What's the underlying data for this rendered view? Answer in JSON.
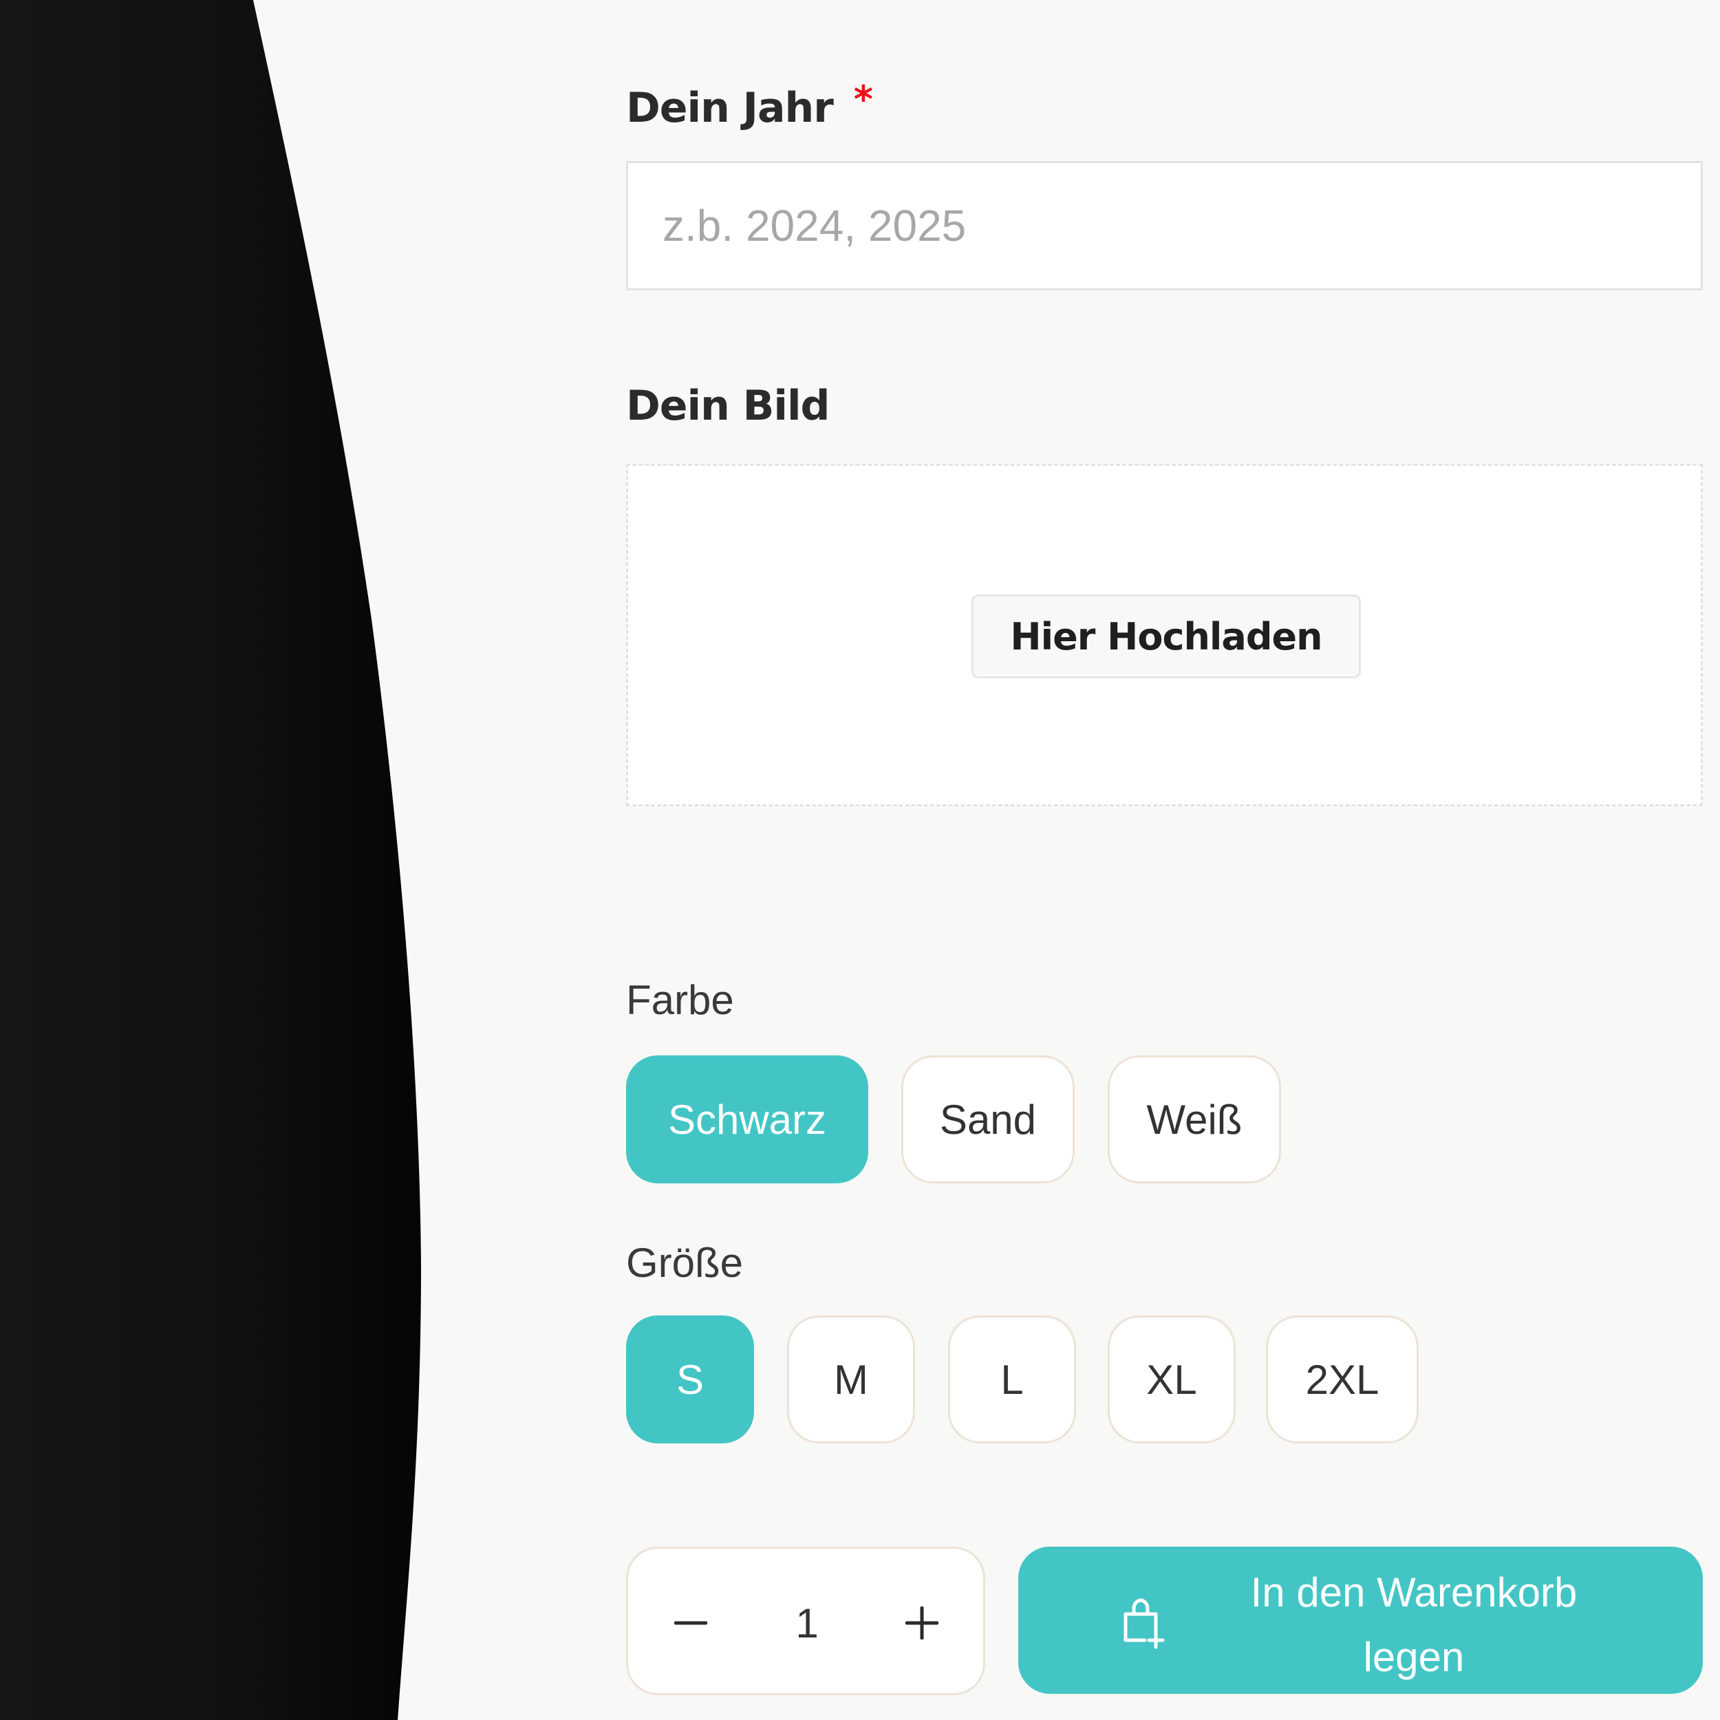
{
  "product_image": {
    "icon": "black-tshirt-edge"
  },
  "year_field": {
    "label": "Dein Jahr",
    "required_marker": "*",
    "value": "",
    "placeholder": "z.b. 2024, 2025"
  },
  "image_field": {
    "label": "Dein Bild",
    "upload_button_label": "Hier Hochladen"
  },
  "color_option": {
    "label": "Farbe",
    "choices": [
      "Schwarz",
      "Sand",
      "Weiß"
    ],
    "selected": "Schwarz"
  },
  "size_option": {
    "label": "Größe",
    "choices": [
      "S",
      "M",
      "L",
      "XL",
      "2XL"
    ],
    "selected": "S"
  },
  "quantity": {
    "value": "1",
    "decrement_icon": "minus-icon",
    "increment_icon": "plus-icon"
  },
  "cart_button": {
    "label": "In den Warenkorb legen",
    "icon": "shopping-bag-plus-icon"
  },
  "colors": {
    "accent": "#43c5c5",
    "required": "#e8121a",
    "background": "#f8f8f6",
    "pill_border": "#ede2d6"
  }
}
